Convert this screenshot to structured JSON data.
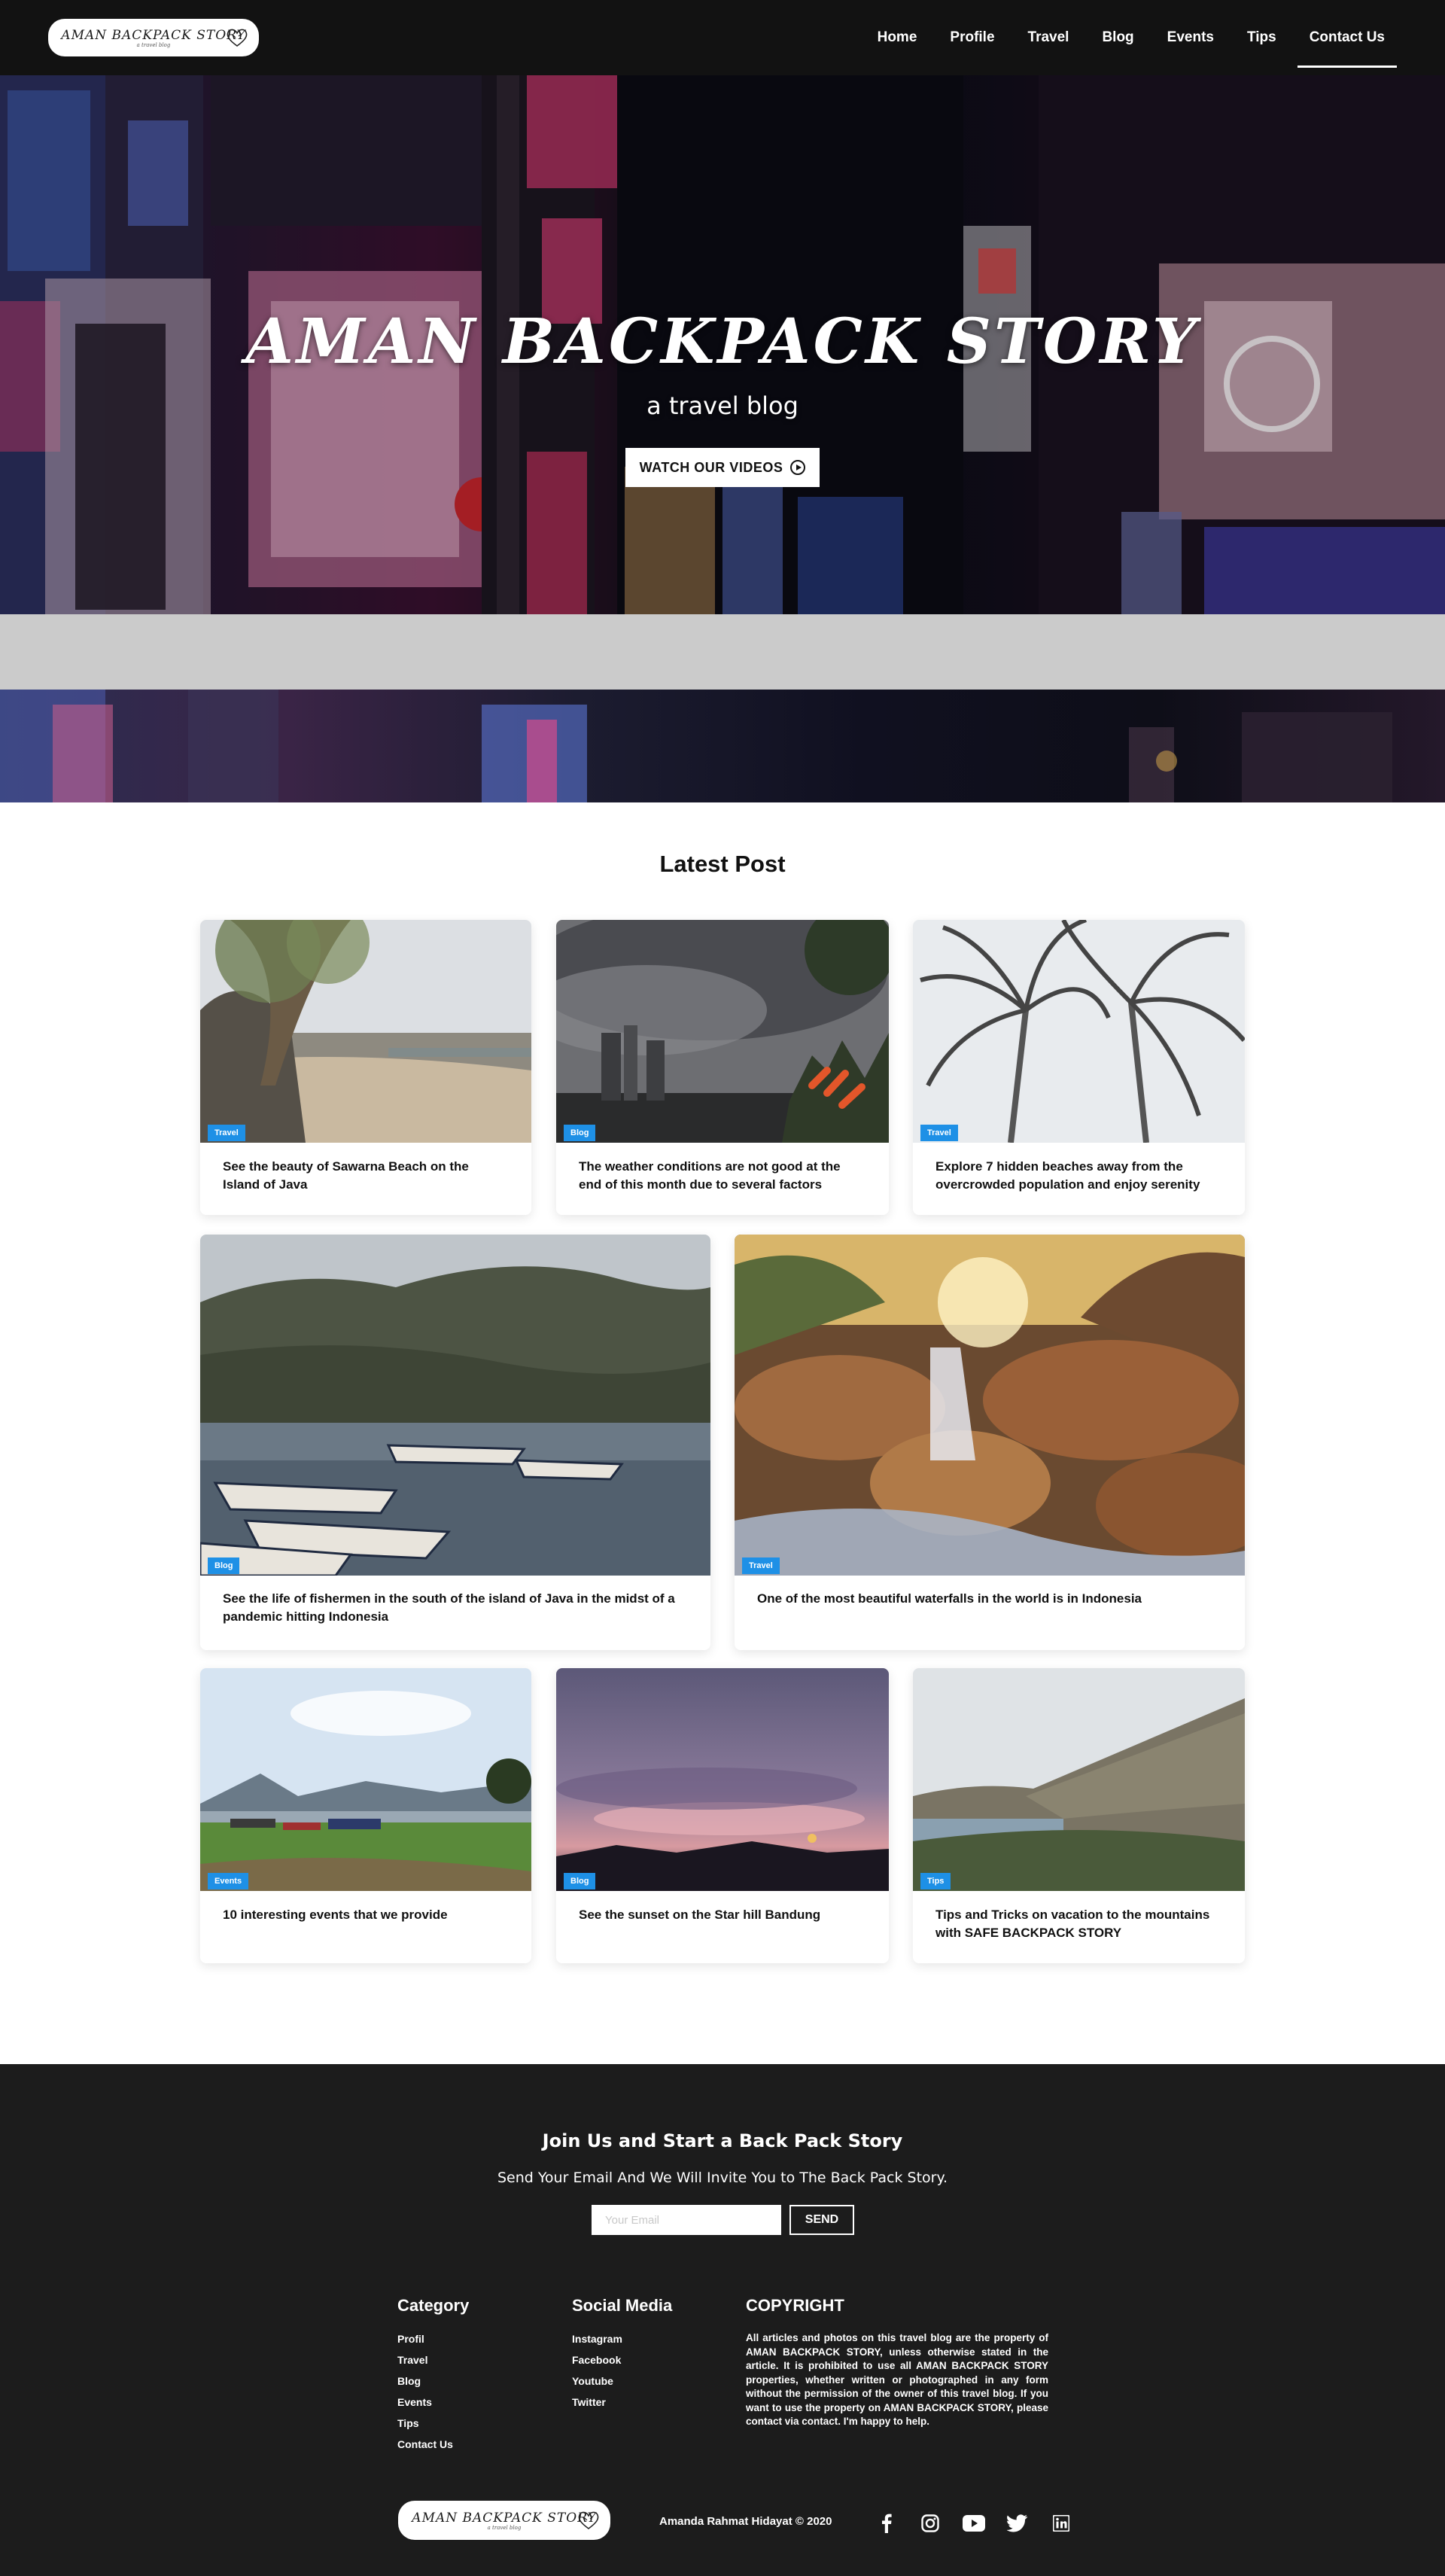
{
  "brand": {
    "logo_text": "AMAN BACKPACK STORY",
    "logo_sub": "a travel blog"
  },
  "nav": {
    "items": [
      "Home",
      "Profile",
      "Travel",
      "Blog",
      "Events",
      "Tips",
      "Contact Us"
    ],
    "active": "Contact Us"
  },
  "hero": {
    "title": "AMAN BACKPACK STORY",
    "subtitle": "a travel blog",
    "cta_label": "WATCH OUR VIDEOS",
    "cta_icon": "play-circle-icon"
  },
  "latest": {
    "heading": "Latest Post",
    "posts": [
      {
        "category": "Travel",
        "title": "See the beauty of Sawarna Beach on the Island of Java"
      },
      {
        "category": "Blog",
        "title": "The weather conditions are not good at the end of this month due to several factors"
      },
      {
        "category": "Travel",
        "title": "Explore 7 hidden beaches away from the overcrowded population and enjoy serenity"
      },
      {
        "category": "Blog",
        "title": "See the life of fishermen in the south of the island of Java in the midst of a pandemic hitting Indonesia"
      },
      {
        "category": "Travel",
        "title": "One of the most beautiful waterfalls in the world is in Indonesia"
      },
      {
        "category": "Events",
        "title": "10 interesting events that we provide"
      },
      {
        "category": "Blog",
        "title": "See the sunset on the Star hill Bandung"
      },
      {
        "category": "Tips",
        "title": "Tips and Tricks on vacation to the mountains with SAFE BACKPACK STORY"
      }
    ]
  },
  "footer": {
    "join_title": "Join Us and Start a Back Pack Story",
    "join_subtitle": "Send Your Email And We Will Invite You to The Back Pack Story.",
    "email_placeholder": "Your Email",
    "send_label": "SEND",
    "category": {
      "heading": "Category",
      "items": [
        "Profil",
        "Travel",
        "Blog",
        "Events",
        "Tips",
        "Contact Us"
      ]
    },
    "social": {
      "heading": "Social Media",
      "items": [
        "Instagram",
        "Facebook",
        "Youtube",
        "Twitter"
      ]
    },
    "copyright": {
      "heading": "COPYRIGHT",
      "text": "All articles and photos on this travel blog are the property of AMAN BACKPACK STORY, unless otherwise stated in the article. It is prohibited to use all AMAN BACKPACK STORY properties, whether written or photographed in any form without the permission of the owner of this travel blog. If you want to use the property on AMAN BACKPACK STORY, please contact via contact. I'm happy to help."
    },
    "credit": "Amanda Rahmat Hidayat © 2020",
    "social_icons": [
      "facebook-icon",
      "instagram-icon",
      "youtube-icon",
      "twitter-icon",
      "linkedin-icon"
    ]
  },
  "colors": {
    "nav_bg": "#121212",
    "footer_bg": "#1c1c1c",
    "badge_blue": "#1e90e6",
    "band_gray": "#cbcbcb"
  }
}
